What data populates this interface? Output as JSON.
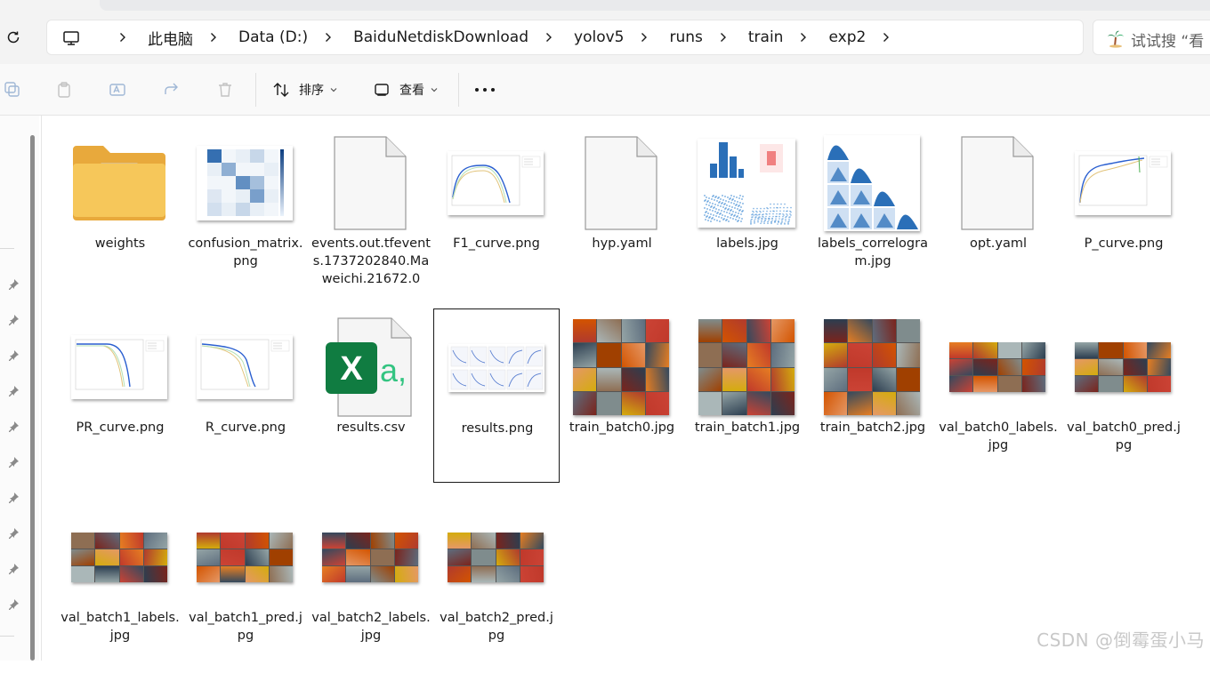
{
  "address_bar": {
    "crumbs": [
      "此电脑",
      "Data (D:)",
      "BaiduNetdiskDownload",
      "yolov5",
      "runs",
      "train",
      "exp2"
    ],
    "search_placeholder": "试试搜 “看"
  },
  "toolbar": {
    "sort_label": "排序",
    "view_label": "查看"
  },
  "files": [
    {
      "name": "weights",
      "type": "folder"
    },
    {
      "name": "confusion_matrix.png",
      "type": "heatmap"
    },
    {
      "name": "events.out.tfevents.1737202840.Maweichi.21672.0",
      "type": "blank"
    },
    {
      "name": "F1_curve.png",
      "type": "curve"
    },
    {
      "name": "hyp.yaml",
      "type": "blank"
    },
    {
      "name": "labels.jpg",
      "type": "labels"
    },
    {
      "name": "labels_correlogram.jpg",
      "type": "correlogram"
    },
    {
      "name": "opt.yaml",
      "type": "blank"
    },
    {
      "name": "P_curve.png",
      "type": "curve"
    },
    {
      "name": "PR_curve.png",
      "type": "curve"
    },
    {
      "name": "R_curve.png",
      "type": "curve"
    },
    {
      "name": "results.csv",
      "type": "excel"
    },
    {
      "name": "results.png",
      "type": "results"
    },
    {
      "name": "train_batch0.jpg",
      "type": "mosaic"
    },
    {
      "name": "train_batch1.jpg",
      "type": "mosaic"
    },
    {
      "name": "train_batch2.jpg",
      "type": "mosaic"
    },
    {
      "name": "val_batch0_labels.jpg",
      "type": "mosaic-wide"
    },
    {
      "name": "val_batch0_pred.jpg",
      "type": "mosaic-wide"
    },
    {
      "name": "val_batch1_labels.jpg",
      "type": "mosaic-wide"
    },
    {
      "name": "val_batch1_pred.jpg",
      "type": "mosaic-wide"
    },
    {
      "name": "val_batch2_labels.jpg",
      "type": "mosaic-wide"
    },
    {
      "name": "val_batch2_pred.jpg",
      "type": "mosaic-wide"
    }
  ],
  "selected_file": "results.png",
  "excel_glyph": "X",
  "excel_glyph2": "a,",
  "watermark": "CSDN @倒霉蛋小马",
  "colors": {
    "accent_blue": "#1f5fa8",
    "excel_green": "#107c41",
    "folder_yellow": "#f6c75a"
  }
}
